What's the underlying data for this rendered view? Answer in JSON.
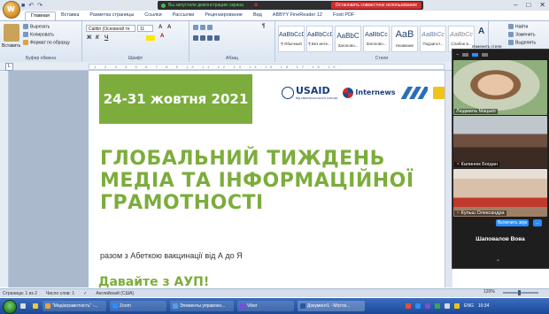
{
  "qat": {
    "undo": "↶",
    "redo": "↷"
  },
  "share_bar": {
    "status": "Вы запустили демонстрацию экрана",
    "stop": "Остановить совместное использование"
  },
  "window_controls": {
    "min": "–",
    "max": "□",
    "close": "✕"
  },
  "tabs": [
    "Главная",
    "Вставка",
    "Разметка страницы",
    "Ссылки",
    "Рассылки",
    "Рецензирование",
    "Вид",
    "ABBYY FineReader 12",
    "Foxit PDF"
  ],
  "ribbon": {
    "clipboard": {
      "label": "Буфер обмена",
      "paste": "Вставить",
      "cut": "Вырезать",
      "copy": "Копировать",
      "format": "Формат по образцу"
    },
    "font": {
      "label": "Шрифт",
      "font_name": "Calibri (Основной те",
      "font_size": "11",
      "bold": "Ж",
      "italic": "К",
      "underline": "Ч"
    },
    "paragraph": {
      "label": "Абзац"
    },
    "styles": {
      "label": "Стили",
      "items": [
        {
          "sample": "AaBbCcDc",
          "name": "¶ Обычный"
        },
        {
          "sample": "AaBbCcDc",
          "name": "¶ Без инте..."
        },
        {
          "sample": "AaBbC",
          "name": "Заголово..."
        },
        {
          "sample": "AaBbCc",
          "name": "Заголово..."
        },
        {
          "sample": "AaB",
          "name": "Название"
        },
        {
          "sample": "AaBbCc",
          "name": "Подзагол..."
        },
        {
          "sample": "AaBbCc",
          "name": "Слабое в..."
        }
      ],
      "change": "Изменить стили"
    },
    "editing": {
      "find": "Найти",
      "replace": "Заменить",
      "select": "Выделить"
    }
  },
  "document": {
    "banner": "24-31 жовтня 2021",
    "logos": {
      "usaid": "USAID",
      "usaid_sub": "ВІД АМЕРИКАНСЬКОГО НАРОДУ",
      "internews": "Internews"
    },
    "headline": "ГЛОБАЛЬНИЙ ТИЖДЕНЬ МЕДІА ТА ІНФОРМАЦІЙНОЇ ГРАМОТНОСТІ",
    "subline": "разом з Абеткою вакцинації від А до Я",
    "cta": "Давайте з АУП!"
  },
  "zoom": {
    "participants": [
      {
        "name": "Людмила Мацько"
      },
      {
        "name": "Калинюк Богдан"
      },
      {
        "name": "Кульш Олександра"
      }
    ],
    "unmute_btn": "Включить звук",
    "more_btn": "...",
    "name_only": "Шаповалов Вова",
    "chevron": "⌄"
  },
  "status_bar": {
    "page": "Страница: 1 из 2",
    "words": "Число слов: 1",
    "language": "Английский (США)",
    "zoom_level": "120%"
  },
  "taskbar": {
    "items": [
      {
        "label": "\"Медіаграмотність\" -...",
        "color": "#e8a43a"
      },
      {
        "label": "Zoom",
        "color": "#2d8cff"
      },
      {
        "label": "Элементы управлен...",
        "color": "#4fa0e6"
      },
      {
        "label": "Viber",
        "color": "#7a4fcf"
      },
      {
        "label": "Документ1 - Micros...",
        "color": "#2b579a"
      }
    ],
    "lang": "ENG",
    "time": "10:34"
  }
}
